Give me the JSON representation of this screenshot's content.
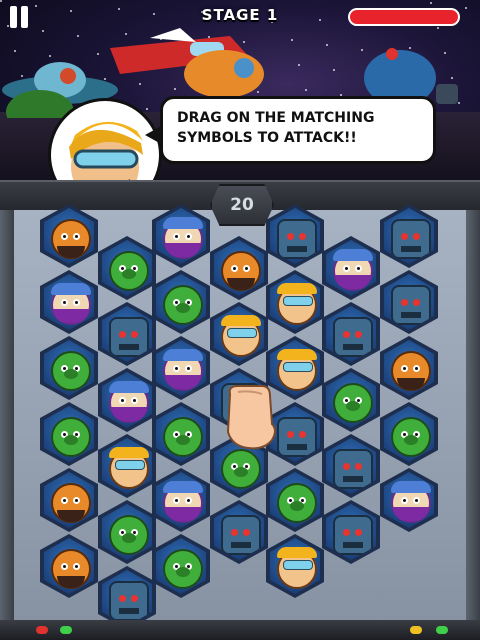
{
  "hud": {
    "pause_icon": "pause-icon",
    "stage_title": "STAGE 1",
    "health_fraction": 1.0,
    "health_color": "#e8232c"
  },
  "tutorial": {
    "line1": "DRAG ON THE MATCHING",
    "line2": "SYMBOLS TO ATTACK!!"
  },
  "counter": {
    "value": "20"
  },
  "board": {
    "tile_types": [
      "orc",
      "pig",
      "bot",
      "ninja",
      "hero"
    ],
    "columns": [
      [
        "orc",
        "ninja",
        "pig",
        "pig",
        "orc",
        "orc"
      ],
      [
        "pig",
        "bot",
        "ninja",
        "hero",
        "pig",
        "bot"
      ],
      [
        "ninja",
        "pig",
        "ninja",
        "pig",
        "ninja",
        "pig"
      ],
      [
        "orc",
        "hero",
        "bot",
        "pig",
        "bot"
      ],
      [
        "bot",
        "hero",
        "hero",
        "bot",
        "pig",
        "hero"
      ],
      [
        "ninja",
        "bot",
        "pig",
        "bot",
        "bot"
      ],
      [
        "bot",
        "bot",
        "orc",
        "pig",
        "ninja"
      ]
    ]
  },
  "colors": {
    "frame": "#3a3d44",
    "tile_blue": "#2f6fb8",
    "led_red": "#e0332e",
    "led_green": "#3fd04a",
    "led_yellow": "#f0c020"
  }
}
